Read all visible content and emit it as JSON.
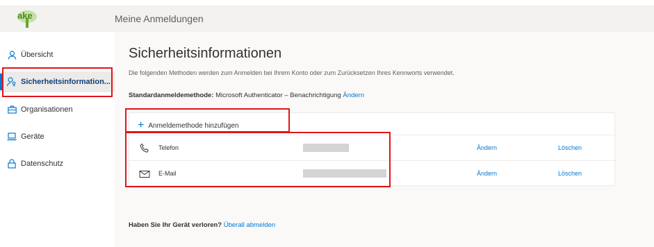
{
  "header": {
    "logo_text": "ake",
    "title": "Meine Anmeldungen"
  },
  "sidebar": {
    "items": [
      {
        "label": "Übersicht",
        "icon": "person-icon"
      },
      {
        "label": "Sicherheitsinformation...",
        "icon": "person-key-icon",
        "active": true
      },
      {
        "label": "Organisationen",
        "icon": "briefcase-icon"
      },
      {
        "label": "Geräte",
        "icon": "laptop-icon"
      },
      {
        "label": "Datenschutz",
        "icon": "lock-icon"
      }
    ]
  },
  "main": {
    "title": "Sicherheitsinformationen",
    "description": "Die folgenden Methoden werden zum Anmelden bei Ihrem Konto oder zum Zurücksetzen Ihres Kennworts verwendet.",
    "default_method_label": "Standardanmeldemethode:",
    "default_method_value": "Microsoft Authenticator – Benachrichtigung",
    "default_method_change": "Ändern",
    "add_method_label": "Anmeldemethode hinzufügen",
    "methods": [
      {
        "icon": "phone-icon",
        "label": "Telefon",
        "change": "Ändern",
        "delete": "Löschen"
      },
      {
        "icon": "mail-icon",
        "label": "E-Mail",
        "change": "Ändern",
        "delete": "Löschen"
      }
    ],
    "lost_device_label": "Haben Sie Ihr Gerät verloren?",
    "lost_device_link": "Überall abmelden"
  },
  "colors": {
    "accent": "#0078d4",
    "highlight": "#e0151b",
    "logo_green": "#6aa42f"
  }
}
